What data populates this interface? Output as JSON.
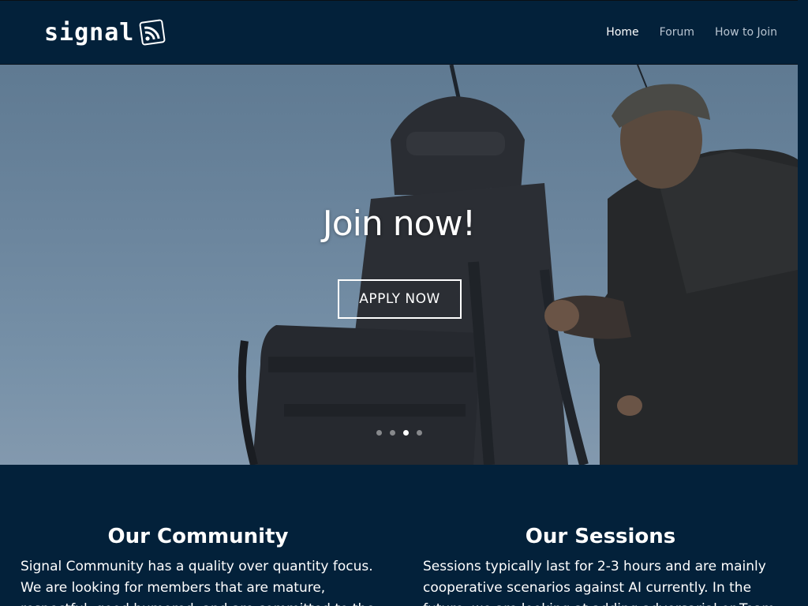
{
  "header": {
    "logo_text": "signal",
    "logo_icon": "rss-feed-icon",
    "nav": [
      {
        "label": "Home",
        "active": true
      },
      {
        "label": "Forum",
        "active": false
      },
      {
        "label": "How to Join",
        "active": false
      }
    ]
  },
  "hero": {
    "title": "Join now!",
    "button_label": "APPLY NOW",
    "slider_dots": 4,
    "active_dot": 3
  },
  "sections": [
    {
      "title": "Our Community",
      "text": "Signal Community has a quality over quantity focus. We are looking for members that are mature, respectful, good humored, and are committed to the"
    },
    {
      "title": "Our Sessions",
      "text": "Sessions typically last for 2-3 hours and are mainly cooperative scenarios against AI currently. In the future, we are looking at adding adversarial or Team"
    }
  ],
  "colors": {
    "header_bg": "#03213a",
    "text": "#ffffff",
    "nav_inactive": "#b8c4d0"
  }
}
